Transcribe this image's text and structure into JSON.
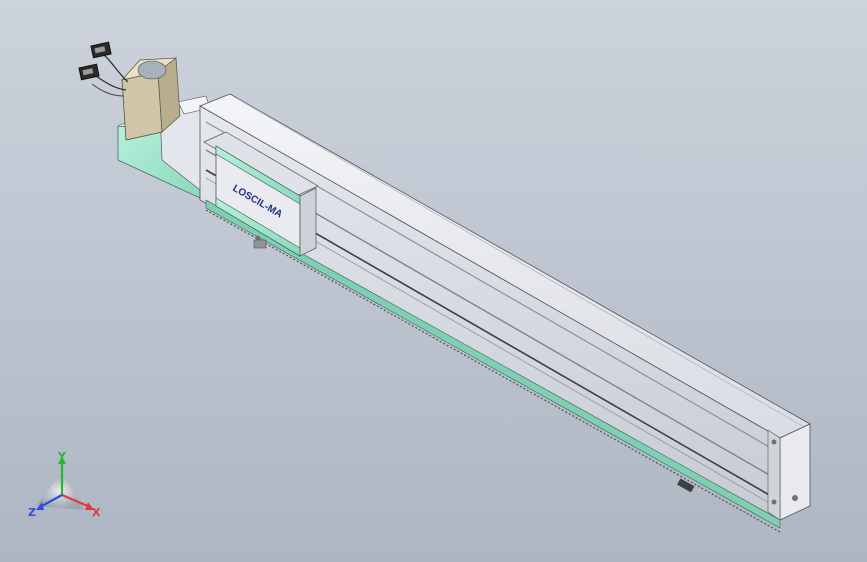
{
  "viewport": {
    "background_top": "#cdd3dc",
    "background_bottom": "#aeb6c3"
  },
  "model": {
    "carriage_logo_text": "LOSCIL-MA",
    "accent_color": "#9fe6cc",
    "rail_color": "#dfe2e8",
    "motor_color": "#cfc6a8"
  },
  "triad": {
    "x_label": "X",
    "y_label": "Y",
    "z_label": "Z",
    "x_color": "#e23b3b",
    "y_color": "#27b53a",
    "z_color": "#2f4fd8"
  }
}
